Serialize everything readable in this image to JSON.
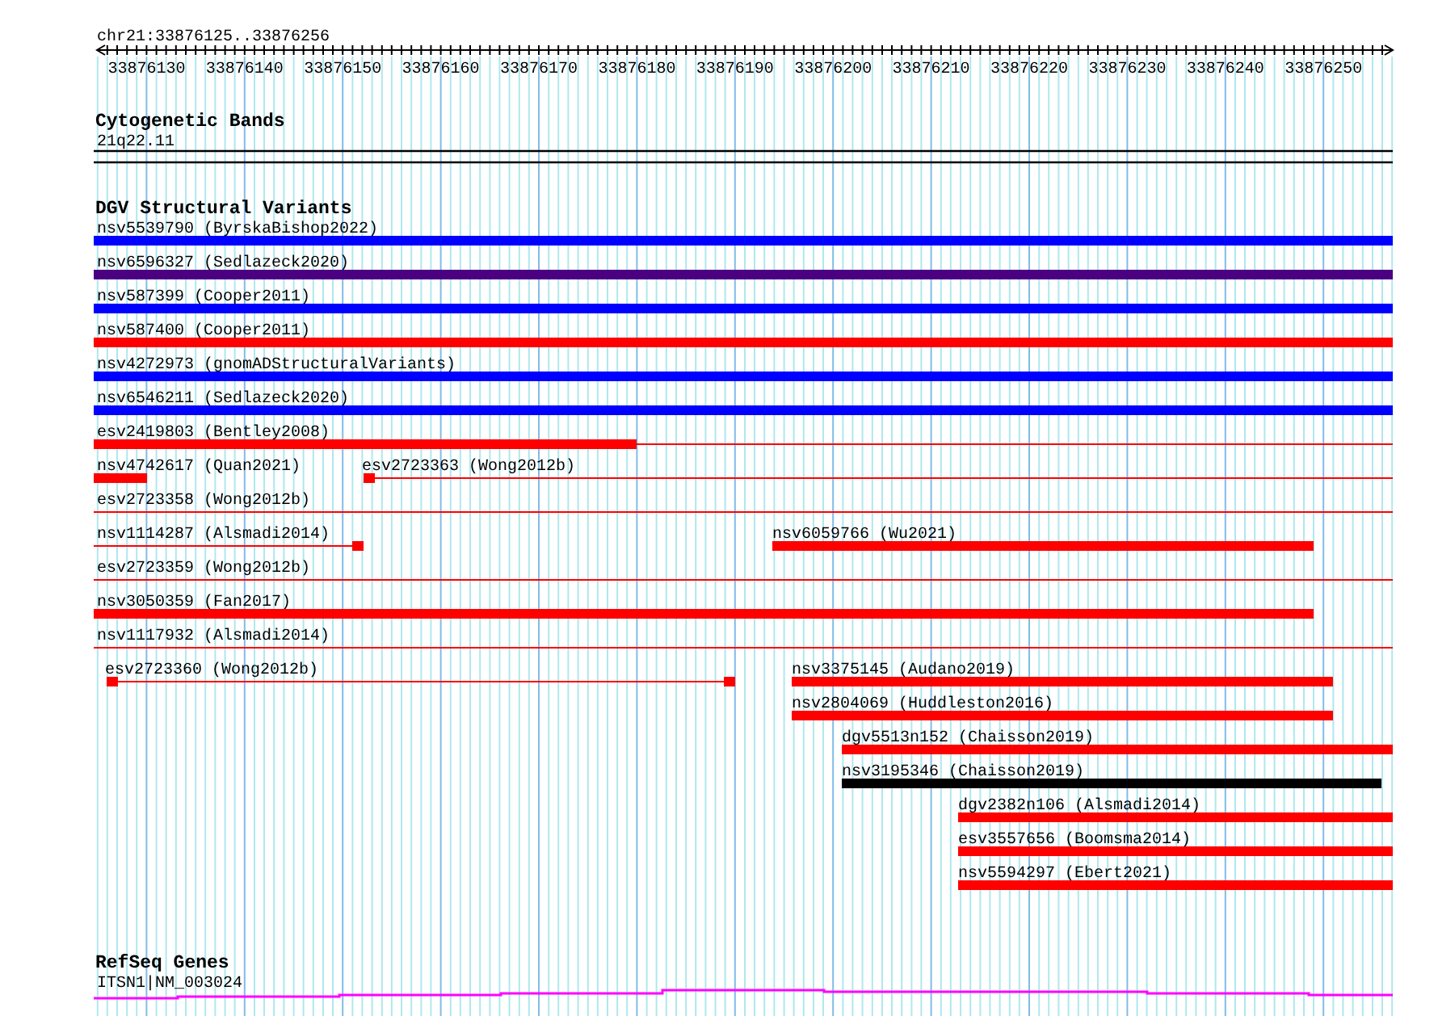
{
  "ruler": {
    "range": "chr21:33876125..33876256",
    "ticks": [
      "33876130",
      "33876140",
      "33876150",
      "33876160",
      "33876170",
      "33876180",
      "33876190",
      "33876200",
      "33876210",
      "33876220",
      "33876230",
      "33876240",
      "33876250"
    ]
  },
  "cytogenetic_bands": {
    "title": "Cytogenetic Bands",
    "band": "21q22.11"
  },
  "dgv_structural_variants": {
    "title": "DGV Structural Variants",
    "features": [
      {
        "label": "nsv5539790 (ByrskaBishop2022)",
        "kind": "bar",
        "color": "#0000ff"
      },
      {
        "label": "nsv6596327 (Sedlazeck2020)",
        "kind": "bar",
        "color": "#4b0082"
      },
      {
        "label": "nsv587399 (Cooper2011)",
        "kind": "bar",
        "color": "#0000ff"
      },
      {
        "label": "nsv587400 (Cooper2011)",
        "kind": "bar",
        "color": "#ff0000"
      },
      {
        "label": "nsv4272973 (gnomADStructuralVariants)",
        "kind": "bar",
        "color": "#0000ff"
      },
      {
        "label": "nsv6546211 (Sedlazeck2020)",
        "kind": "bar",
        "color": "#0000ff"
      },
      {
        "label": "esv2419803 (Bentley2008)",
        "kind": "bar-line",
        "color": "#ff0000"
      },
      {
        "label": "nsv4742617 (Quan2021)",
        "kind": "bar",
        "color": "#ff0000"
      },
      {
        "label": "esv2723363 (Wong2012b)",
        "kind": "block-line",
        "color": "#ff0000"
      },
      {
        "label": "esv2723358 (Wong2012b)",
        "kind": "line",
        "color": "#ff0000"
      },
      {
        "label": "nsv1114287 (Alsmadi2014)",
        "kind": "line-block",
        "color": "#ff0000"
      },
      {
        "label": "nsv6059766 (Wu2021)",
        "kind": "bar",
        "color": "#ff0000"
      },
      {
        "label": "esv2723359 (Wong2012b)",
        "kind": "line",
        "color": "#ff0000"
      },
      {
        "label": "nsv3050359 (Fan2017)",
        "kind": "bar",
        "color": "#ff0000"
      },
      {
        "label": "nsv1117932 (Alsmadi2014)",
        "kind": "line",
        "color": "#ff0000"
      },
      {
        "label": "esv2723360 (Wong2012b)",
        "kind": "block-line-block",
        "color": "#ff0000"
      },
      {
        "label": "nsv3375145 (Audano2019)",
        "kind": "bar",
        "color": "#ff0000"
      },
      {
        "label": "nsv2804069 (Huddleston2016)",
        "kind": "bar",
        "color": "#ff0000"
      },
      {
        "label": "dgv5513n152 (Chaisson2019)",
        "kind": "bar",
        "color": "#ff0000"
      },
      {
        "label": "nsv3195346 (Chaisson2019)",
        "kind": "bar",
        "color": "#000000"
      },
      {
        "label": "dgv2382n106 (Alsmadi2014)",
        "kind": "bar",
        "color": "#ff0000"
      },
      {
        "label": "esv3557656 (Boomsma2014)",
        "kind": "bar",
        "color": "#ff0000"
      },
      {
        "label": "nsv5594297 (Ebert2021)",
        "kind": "bar",
        "color": "#ff0000"
      }
    ]
  },
  "refseq_genes": {
    "title": "RefSeq Genes",
    "gene": "ITSN1|NM_003024"
  }
}
